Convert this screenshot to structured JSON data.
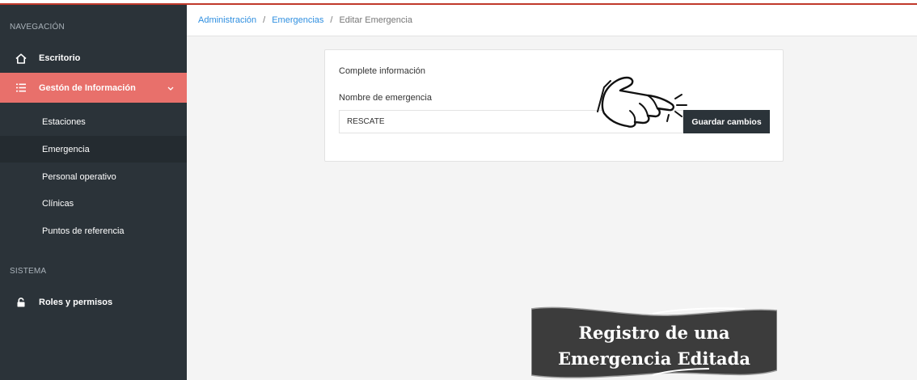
{
  "sidebar": {
    "sections": {
      "navigation": "NAVEGACIÓN",
      "system": "SISTEMA"
    },
    "items": [
      {
        "label": "Escritorio",
        "icon": "home-icon"
      },
      {
        "label": "Gestón de Información",
        "icon": "list-icon",
        "expanded": true
      },
      {
        "label": "Roles y permisos",
        "icon": "lock-icon"
      }
    ],
    "subitems": [
      {
        "label": "Estaciones"
      },
      {
        "label": "Emergencia",
        "selected": true
      },
      {
        "label": "Personal operativo"
      },
      {
        "label": "Clínicas"
      },
      {
        "label": "Puntos de referencia"
      }
    ]
  },
  "breadcrumb": {
    "items": [
      "Administración",
      "Emergencias"
    ],
    "separator": "/",
    "current": "Editar Emergencia"
  },
  "form": {
    "title": "Complete información",
    "field_label": "Nombre de emergencia",
    "field_value": "RESCATE",
    "save_label": "Guardar cambios"
  },
  "overlay": {
    "line1": "Registro de una",
    "line2": "Emergencia Editada"
  },
  "colors": {
    "sidebar_bg": "#2b3339",
    "active_item": "#e8706b",
    "link": "#2f8fe0",
    "accent_top": "#c0392b",
    "button_bg": "#2b3339"
  }
}
